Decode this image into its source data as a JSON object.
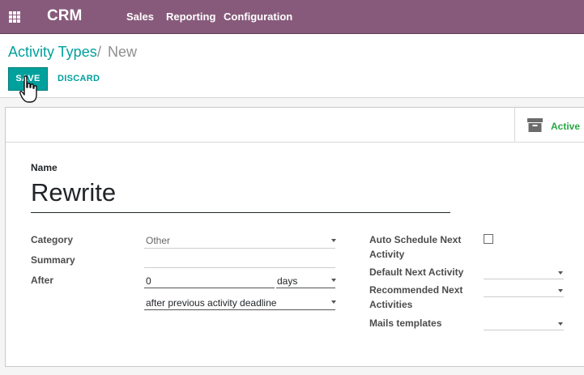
{
  "topbar": {
    "app_name": "CRM",
    "menu": [
      "Sales",
      "Reporting",
      "Configuration"
    ]
  },
  "breadcrumb": {
    "parent": "Activity Types",
    "separator": "/",
    "current": "New"
  },
  "buttons": {
    "save": "SAVE",
    "discard": "DISCARD"
  },
  "button_box": {
    "active_label": "Active"
  },
  "form": {
    "name_label": "Name",
    "name_value": "Rewrite",
    "category_label": "Category",
    "category_value": "Other",
    "summary_label": "Summary",
    "summary_value": "",
    "after_label": "After",
    "after_value": "0",
    "after_unit": "days",
    "after_from": "after previous activity deadline",
    "auto_schedule_label": "Auto Schedule Next Activity",
    "auto_schedule_checked": false,
    "default_next_label": "Default Next Activity",
    "default_next_value": "",
    "recommended_next_label": "Recommended Next Activities",
    "recommended_next_value": "",
    "mail_templates_label": "Mails templates",
    "mail_templates_value": ""
  },
  "colors": {
    "topbar": "#875a7b",
    "primary": "#00a09d",
    "active": "#28a745"
  },
  "icons": [
    "apps-grid-icon",
    "hand-pointer-cursor-icon",
    "archive-box-icon",
    "dropdown-caret-icon"
  ]
}
